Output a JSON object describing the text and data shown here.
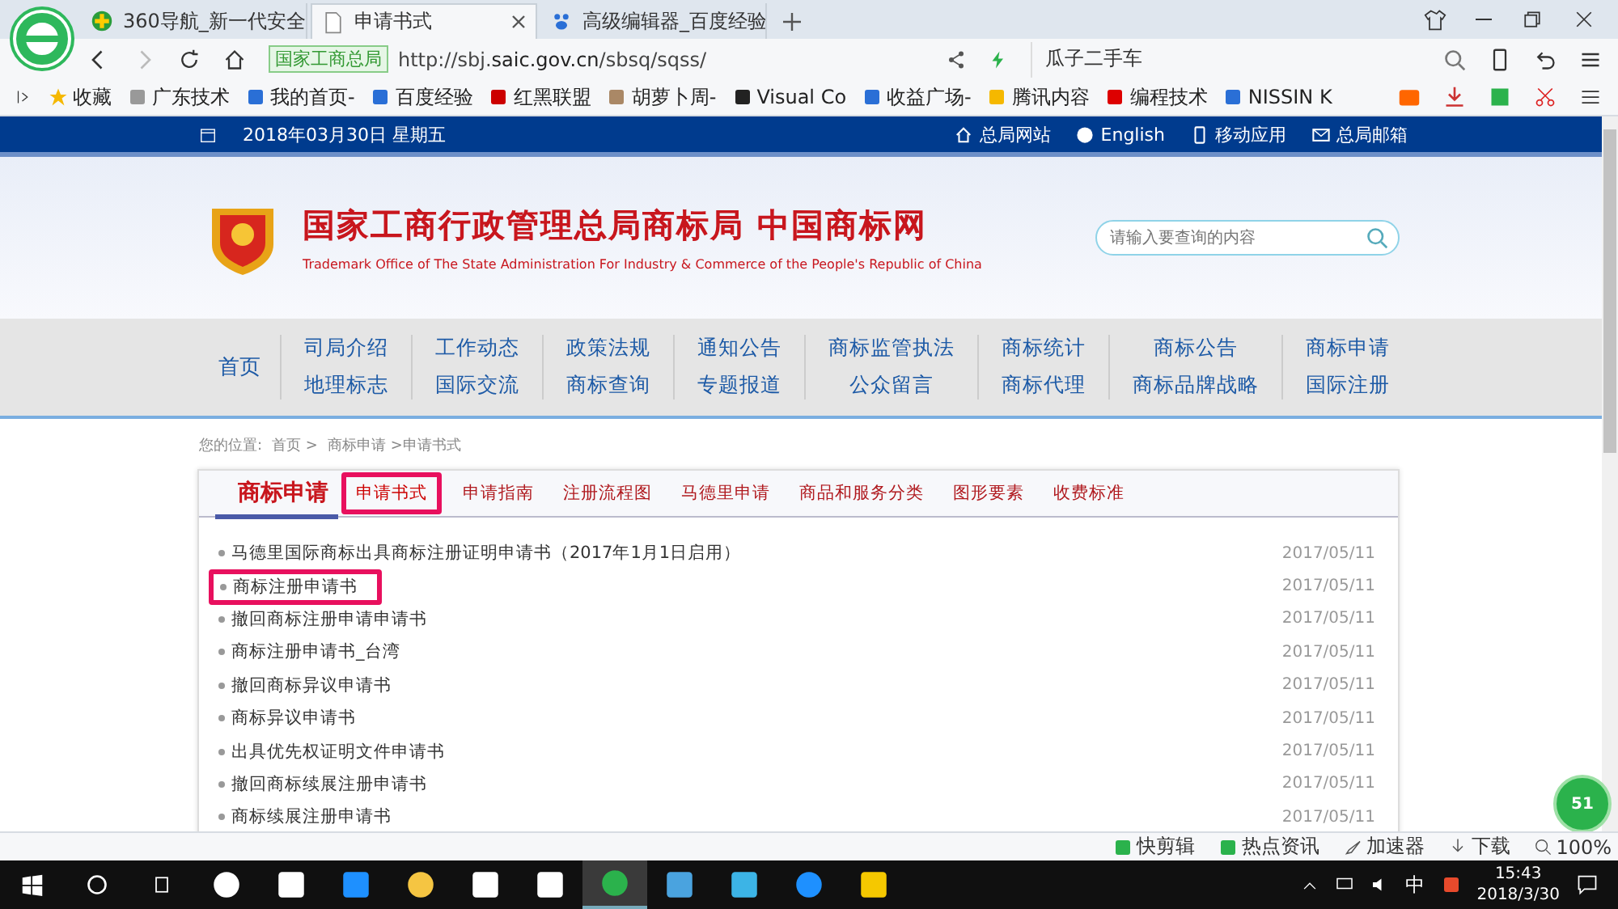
{
  "browser": {
    "tabs": [
      {
        "label": "360导航_新一代安全",
        "selected": false
      },
      {
        "label": "申请书式",
        "selected": true
      },
      {
        "label": "高级编辑器_百度经验",
        "selected": false
      }
    ],
    "address": {
      "site_badge": "国家工商总局",
      "url": "http://sbj.**saic.gov.cn**/sbsq/sqss/"
    },
    "search_value": "瓜子二手车",
    "bookmarks": [
      "收藏",
      "广东技术",
      "我的首页-",
      "百度经验",
      "红黑联盟",
      "胡萝卜周-",
      "Visual Co",
      "收益广场-",
      "腾讯内容",
      "编程技术",
      "NISSIN K"
    ],
    "status_items": [
      "快剪辑",
      "热点资讯",
      "加速器",
      "下载"
    ],
    "zoom": "100%"
  },
  "page": {
    "date": "2018年03月30日 星期五",
    "top_links": [
      "总局网站",
      "English",
      "移动应用",
      "总局邮箱"
    ],
    "title": "国家工商行政管理总局商标局 中国商标网",
    "subtitle": "Trademark Office of The State Administration For Industry & Commerce of the People's Republic of China",
    "search_placeholder": "请输入要查询的内容",
    "nav_home": "首页",
    "nav": [
      [
        "司局介绍",
        "地理标志"
      ],
      [
        "工作动态",
        "国际交流"
      ],
      [
        "政策法规",
        "商标查询"
      ],
      [
        "通知公告",
        "专题报道"
      ],
      [
        "商标监管执法",
        "公众留言"
      ],
      [
        "商标统计",
        "商标代理"
      ],
      [
        "商标公告",
        "商标品牌战略"
      ],
      [
        "商标申请",
        "国际注册"
      ]
    ],
    "breadcrumb": [
      "您的位置:",
      "首页 >",
      "商标申请 >申请书式"
    ],
    "panel_title": "商标申请",
    "subtabs": [
      {
        "label": "申请书式",
        "selected": true,
        "highlighted": true
      },
      {
        "label": "申请指南",
        "selected": false,
        "highlighted": false
      },
      {
        "label": "注册流程图",
        "selected": false,
        "highlighted": false
      },
      {
        "label": "马德里申请",
        "selected": false,
        "highlighted": false
      },
      {
        "label": "商品和服务分类",
        "selected": false,
        "highlighted": false
      },
      {
        "label": "图形要素",
        "selected": false,
        "highlighted": false
      },
      {
        "label": "收费标准",
        "selected": false,
        "highlighted": false
      }
    ],
    "rows": [
      {
        "title": "马德里国际商标出具商标注册证明申请书（2017年1月1日启用）",
        "date": "2017/05/11",
        "highlighted": false
      },
      {
        "title": "商标注册申请书",
        "date": "2017/05/11",
        "highlighted": true
      },
      {
        "title": "撤回商标注册申请申请书",
        "date": "2017/05/11",
        "highlighted": false
      },
      {
        "title": "商标注册申请书_台湾",
        "date": "2017/05/11",
        "highlighted": false
      },
      {
        "title": "撤回商标异议申请书",
        "date": "2017/05/11",
        "highlighted": false
      },
      {
        "title": "商标异议申请书",
        "date": "2017/05/11",
        "highlighted": false
      },
      {
        "title": "出具优先权证明文件申请书",
        "date": "2017/05/11",
        "highlighted": false
      },
      {
        "title": "撤回商标续展注册申请书",
        "date": "2017/05/11",
        "highlighted": false
      },
      {
        "title": "商标续展注册申请书",
        "date": "2017/05/11",
        "highlighted": false
      }
    ],
    "float_badge": "51"
  },
  "taskbar": {
    "ime": "中",
    "time": "15:43",
    "date": "2018/3/30"
  }
}
